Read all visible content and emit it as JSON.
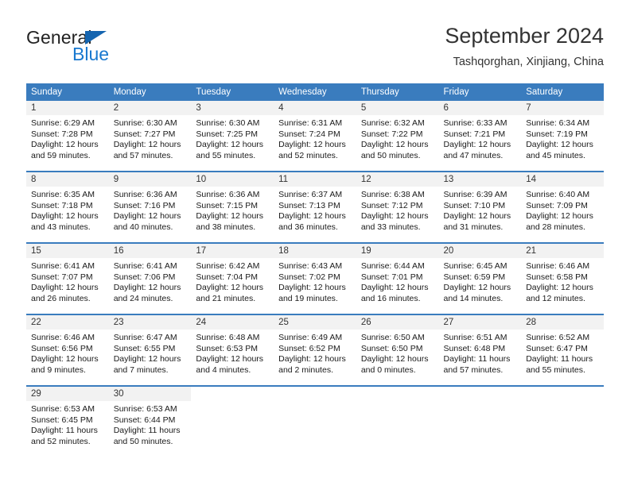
{
  "brand": {
    "name_part1": "General",
    "name_part2": "Blue",
    "triangle_color": "#1565b0",
    "blue_color": "#1878cf"
  },
  "header": {
    "title": "September 2024",
    "subtitle": "Tashqorghan, Xinjiang, China"
  },
  "theme": {
    "header_blue": "#3a7cbe",
    "daynum_gray": "#f2f2f2"
  },
  "weekdays": [
    "Sunday",
    "Monday",
    "Tuesday",
    "Wednesday",
    "Thursday",
    "Friday",
    "Saturday"
  ],
  "labels": {
    "sunrise_prefix": "Sunrise:",
    "sunset_prefix": "Sunset:",
    "daylight_prefix": "Daylight:"
  },
  "weeks": [
    [
      {
        "day": "1",
        "sunrise": "Sunrise: 6:29 AM",
        "sunset": "Sunset: 7:28 PM",
        "daylight": "Daylight: 12 hours and 59 minutes."
      },
      {
        "day": "2",
        "sunrise": "Sunrise: 6:30 AM",
        "sunset": "Sunset: 7:27 PM",
        "daylight": "Daylight: 12 hours and 57 minutes."
      },
      {
        "day": "3",
        "sunrise": "Sunrise: 6:30 AM",
        "sunset": "Sunset: 7:25 PM",
        "daylight": "Daylight: 12 hours and 55 minutes."
      },
      {
        "day": "4",
        "sunrise": "Sunrise: 6:31 AM",
        "sunset": "Sunset: 7:24 PM",
        "daylight": "Daylight: 12 hours and 52 minutes."
      },
      {
        "day": "5",
        "sunrise": "Sunrise: 6:32 AM",
        "sunset": "Sunset: 7:22 PM",
        "daylight": "Daylight: 12 hours and 50 minutes."
      },
      {
        "day": "6",
        "sunrise": "Sunrise: 6:33 AM",
        "sunset": "Sunset: 7:21 PM",
        "daylight": "Daylight: 12 hours and 47 minutes."
      },
      {
        "day": "7",
        "sunrise": "Sunrise: 6:34 AM",
        "sunset": "Sunset: 7:19 PM",
        "daylight": "Daylight: 12 hours and 45 minutes."
      }
    ],
    [
      {
        "day": "8",
        "sunrise": "Sunrise: 6:35 AM",
        "sunset": "Sunset: 7:18 PM",
        "daylight": "Daylight: 12 hours and 43 minutes."
      },
      {
        "day": "9",
        "sunrise": "Sunrise: 6:36 AM",
        "sunset": "Sunset: 7:16 PM",
        "daylight": "Daylight: 12 hours and 40 minutes."
      },
      {
        "day": "10",
        "sunrise": "Sunrise: 6:36 AM",
        "sunset": "Sunset: 7:15 PM",
        "daylight": "Daylight: 12 hours and 38 minutes."
      },
      {
        "day": "11",
        "sunrise": "Sunrise: 6:37 AM",
        "sunset": "Sunset: 7:13 PM",
        "daylight": "Daylight: 12 hours and 36 minutes."
      },
      {
        "day": "12",
        "sunrise": "Sunrise: 6:38 AM",
        "sunset": "Sunset: 7:12 PM",
        "daylight": "Daylight: 12 hours and 33 minutes."
      },
      {
        "day": "13",
        "sunrise": "Sunrise: 6:39 AM",
        "sunset": "Sunset: 7:10 PM",
        "daylight": "Daylight: 12 hours and 31 minutes."
      },
      {
        "day": "14",
        "sunrise": "Sunrise: 6:40 AM",
        "sunset": "Sunset: 7:09 PM",
        "daylight": "Daylight: 12 hours and 28 minutes."
      }
    ],
    [
      {
        "day": "15",
        "sunrise": "Sunrise: 6:41 AM",
        "sunset": "Sunset: 7:07 PM",
        "daylight": "Daylight: 12 hours and 26 minutes."
      },
      {
        "day": "16",
        "sunrise": "Sunrise: 6:41 AM",
        "sunset": "Sunset: 7:06 PM",
        "daylight": "Daylight: 12 hours and 24 minutes."
      },
      {
        "day": "17",
        "sunrise": "Sunrise: 6:42 AM",
        "sunset": "Sunset: 7:04 PM",
        "daylight": "Daylight: 12 hours and 21 minutes."
      },
      {
        "day": "18",
        "sunrise": "Sunrise: 6:43 AM",
        "sunset": "Sunset: 7:02 PM",
        "daylight": "Daylight: 12 hours and 19 minutes."
      },
      {
        "day": "19",
        "sunrise": "Sunrise: 6:44 AM",
        "sunset": "Sunset: 7:01 PM",
        "daylight": "Daylight: 12 hours and 16 minutes."
      },
      {
        "day": "20",
        "sunrise": "Sunrise: 6:45 AM",
        "sunset": "Sunset: 6:59 PM",
        "daylight": "Daylight: 12 hours and 14 minutes."
      },
      {
        "day": "21",
        "sunrise": "Sunrise: 6:46 AM",
        "sunset": "Sunset: 6:58 PM",
        "daylight": "Daylight: 12 hours and 12 minutes."
      }
    ],
    [
      {
        "day": "22",
        "sunrise": "Sunrise: 6:46 AM",
        "sunset": "Sunset: 6:56 PM",
        "daylight": "Daylight: 12 hours and 9 minutes."
      },
      {
        "day": "23",
        "sunrise": "Sunrise: 6:47 AM",
        "sunset": "Sunset: 6:55 PM",
        "daylight": "Daylight: 12 hours and 7 minutes."
      },
      {
        "day": "24",
        "sunrise": "Sunrise: 6:48 AM",
        "sunset": "Sunset: 6:53 PM",
        "daylight": "Daylight: 12 hours and 4 minutes."
      },
      {
        "day": "25",
        "sunrise": "Sunrise: 6:49 AM",
        "sunset": "Sunset: 6:52 PM",
        "daylight": "Daylight: 12 hours and 2 minutes."
      },
      {
        "day": "26",
        "sunrise": "Sunrise: 6:50 AM",
        "sunset": "Sunset: 6:50 PM",
        "daylight": "Daylight: 12 hours and 0 minutes."
      },
      {
        "day": "27",
        "sunrise": "Sunrise: 6:51 AM",
        "sunset": "Sunset: 6:48 PM",
        "daylight": "Daylight: 11 hours and 57 minutes."
      },
      {
        "day": "28",
        "sunrise": "Sunrise: 6:52 AM",
        "sunset": "Sunset: 6:47 PM",
        "daylight": "Daylight: 11 hours and 55 minutes."
      }
    ],
    [
      {
        "day": "29",
        "sunrise": "Sunrise: 6:53 AM",
        "sunset": "Sunset: 6:45 PM",
        "daylight": "Daylight: 11 hours and 52 minutes."
      },
      {
        "day": "30",
        "sunrise": "Sunrise: 6:53 AM",
        "sunset": "Sunset: 6:44 PM",
        "daylight": "Daylight: 11 hours and 50 minutes."
      },
      {
        "day": "",
        "sunrise": "",
        "sunset": "",
        "daylight": ""
      },
      {
        "day": "",
        "sunrise": "",
        "sunset": "",
        "daylight": ""
      },
      {
        "day": "",
        "sunrise": "",
        "sunset": "",
        "daylight": ""
      },
      {
        "day": "",
        "sunrise": "",
        "sunset": "",
        "daylight": ""
      },
      {
        "day": "",
        "sunrise": "",
        "sunset": "",
        "daylight": ""
      }
    ]
  ]
}
